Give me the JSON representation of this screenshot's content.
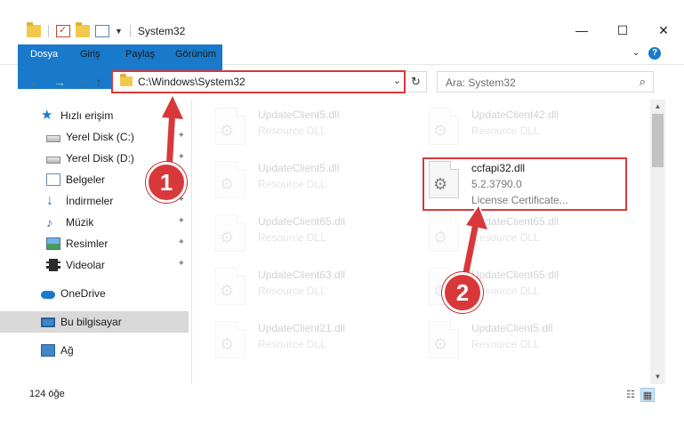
{
  "window": {
    "title": "System32",
    "controls": {
      "minimize": "—",
      "maximize": "☐",
      "close": "✕"
    }
  },
  "ribbon": {
    "tabs": [
      "Dosya",
      "Giriş",
      "Paylaş",
      "Görünüm"
    ],
    "expand_glyph": "⌄",
    "help_glyph": "?"
  },
  "nav": {
    "back": "←",
    "forward": "→",
    "recent": "⌄",
    "up": "↑",
    "address": "C:\\Windows\\System32",
    "dropdown": "⌄",
    "refresh": "↻",
    "search_placeholder": "Ara: System32",
    "search_glyph": "⌕"
  },
  "sidebar": {
    "items": [
      {
        "label": "Hızlı erişim",
        "icon": "star-icon"
      },
      {
        "label": "Yerel Disk (C:)",
        "icon": "drive-icon",
        "pinned": true
      },
      {
        "label": "Yerel Disk (D:)",
        "icon": "drive-icon",
        "pinned": true
      },
      {
        "label": "Belgeler",
        "icon": "documents-icon",
        "pinned": true
      },
      {
        "label": "İndirmeler",
        "icon": "download-icon",
        "pinned": true
      },
      {
        "label": "Müzik",
        "icon": "music-icon",
        "pinned": true
      },
      {
        "label": "Resimler",
        "icon": "pictures-icon",
        "pinned": true
      },
      {
        "label": "Videolar",
        "icon": "videos-icon",
        "pinned": true
      },
      {
        "label": "OneDrive",
        "icon": "onedrive-icon"
      },
      {
        "label": "Bu bilgisayar",
        "icon": "this-pc-icon",
        "selected": true
      },
      {
        "label": "Ağ",
        "icon": "network-icon"
      }
    ],
    "pin_glyph": "📌"
  },
  "files": [
    {
      "name": "UpdateClient5.dll",
      "type": "Resource DLL"
    },
    {
      "name": "UpdateClient42.dll",
      "type": "Resource DLL"
    },
    {
      "name": "UpdateClient5.dll",
      "type": "Resource DLL"
    },
    {
      "name": "ccfapi32.dll",
      "version": "5.2.3790.0",
      "description": "License Certificate..."
    },
    {
      "name": "UpdateClient65.dll",
      "type": "Resource DLL"
    },
    {
      "name": "UpdateClient65.dll",
      "type": "Resource DLL"
    },
    {
      "name": "UpdateClient63.dll",
      "type": "Resource DLL"
    },
    {
      "name": "UpdateClient65.dll",
      "type": "Resource DLL"
    },
    {
      "name": "UpdateClient21.dll",
      "type": "Resource DLL"
    },
    {
      "name": "UpdateClient5.dll",
      "type": "Resource DLL"
    }
  ],
  "status": {
    "item_count": "124 öğe"
  },
  "annotations": {
    "marker1": "1",
    "marker2": "2",
    "color": "#d9383b"
  }
}
